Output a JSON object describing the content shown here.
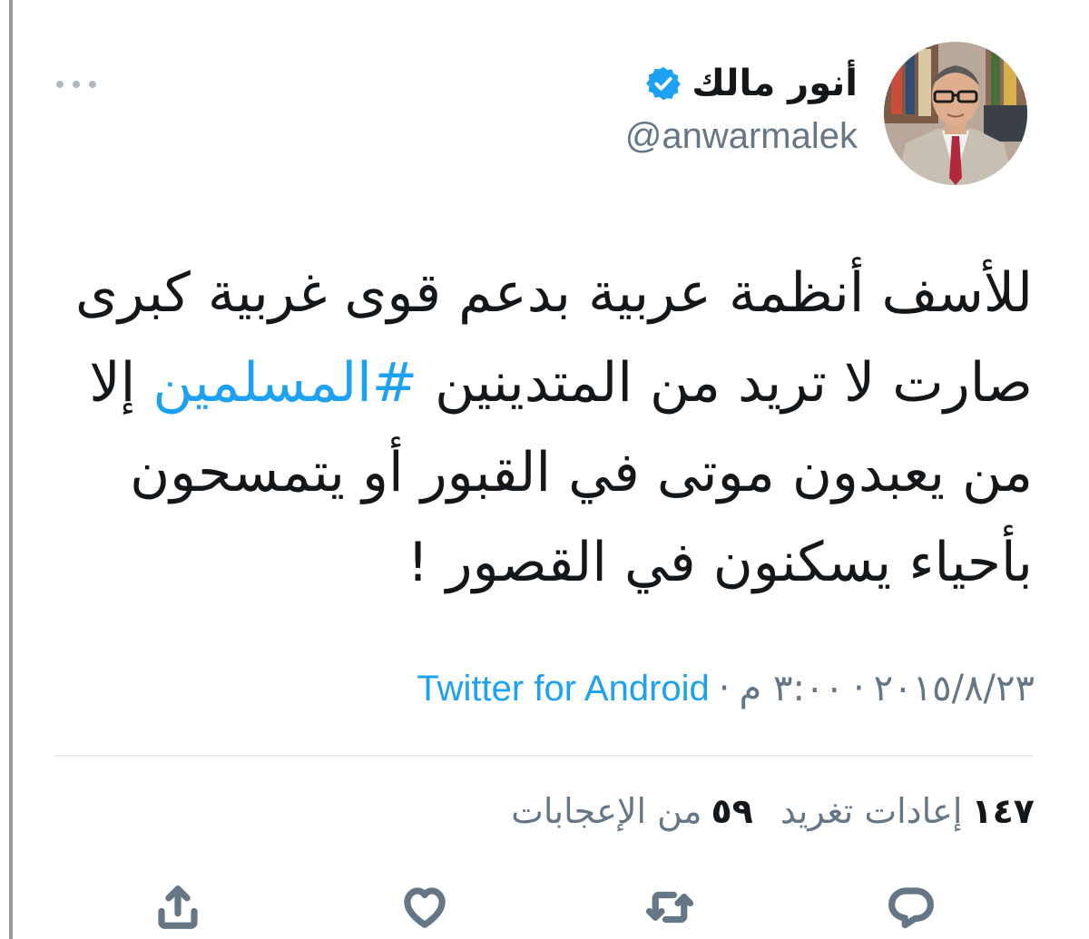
{
  "tweet": {
    "author": {
      "display_name": "أنور مالك",
      "handle": "@anwarmalek",
      "verified": true,
      "avatar_icon": "profile-photo"
    },
    "text_lines": [
      {
        "text": "للأسف أنظمة عربية بدعم قوى غربية كبرى"
      },
      {
        "before": "صارت لا تريد من المتدينين ",
        "hashtag": "#المسلمين",
        "after": " إلا"
      },
      {
        "text": "من يعبدون موتى في القبور أو يتمسحون"
      },
      {
        "text": "بأحياء يسكنون في القصور !"
      }
    ],
    "meta": {
      "date": "٢٠١٥/٨/٢٣",
      "separator": "·",
      "time": "٣:٠٠ م",
      "source": "Twitter for Android"
    },
    "stats": {
      "retweets_count": "١٤٧",
      "retweets_label": "إعادات تغريد",
      "likes_count": "٥٩",
      "likes_label": "من الإعجابات"
    },
    "actions": [
      "reply-icon",
      "retweet-icon",
      "like-icon",
      "share-icon"
    ],
    "colors": {
      "link": "#1da1f2",
      "secondary_text": "#657786",
      "primary_text": "#14171a",
      "divider": "#e6ecf0",
      "verified_badge": "#1da1f2"
    }
  }
}
